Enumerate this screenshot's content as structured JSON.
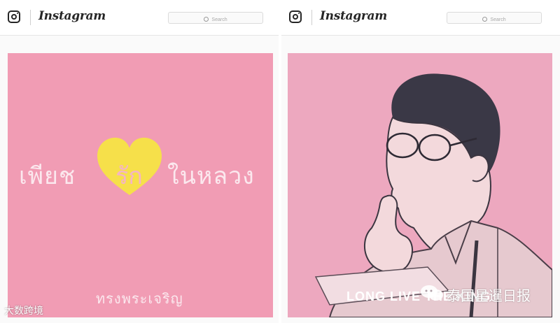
{
  "screens": [
    {
      "app_name": "Instagram",
      "search_placeholder": "Search",
      "post": {
        "text_left": "เพียช",
        "heart_text": "รัก",
        "text_right": "ในหลวง",
        "signature": "ทรงพระเจริญ",
        "background_color": "#f19cb4",
        "heart_color": "#f6e04a"
      }
    },
    {
      "app_name": "Instagram",
      "search_placeholder": "Search",
      "post": {
        "caption": "LONG LIVE THE KING",
        "background_color": "#eda8bf"
      }
    }
  ],
  "watermarks": {
    "bottom_left": "大数跨境",
    "bottom_right": "泰国星暹日报"
  },
  "icons": {
    "logo": "instagram-camera-icon",
    "search": "search-icon",
    "watermark": "chat-bubble-icon"
  }
}
